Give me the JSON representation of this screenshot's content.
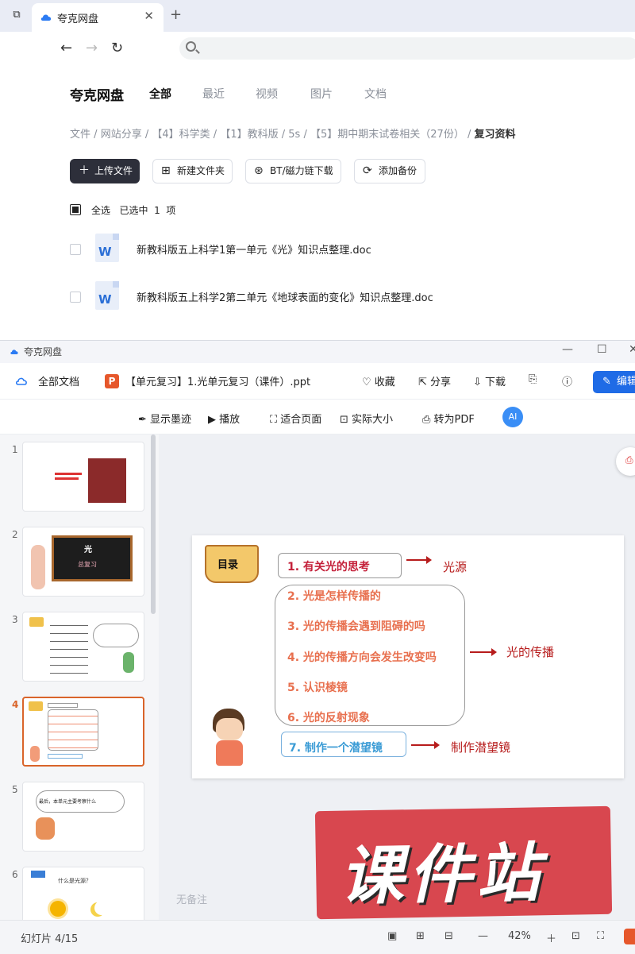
{
  "browser": {
    "tab_title": "夸克网盘",
    "close_glyph": "✕",
    "new_tab_glyph": "+"
  },
  "drive": {
    "brand": "夸克网盘",
    "tabs": [
      "全部",
      "最近",
      "视频",
      "图片",
      "文档"
    ],
    "active_tab": "全部",
    "breadcrumb": [
      "文件",
      "网站分享",
      "【4】科学类",
      "【1】教科版",
      "5s",
      "【5】期中期末试卷相关（27份）",
      "复习资料"
    ],
    "breadcrumb_sep": "/",
    "buttons": {
      "upload": "上传文件",
      "new_folder": "新建文件夹",
      "bt": "BT/磁力链下载",
      "backup": "添加备份"
    },
    "select_all": "全选",
    "selected_text": "已选中",
    "selected_count": "1",
    "selected_unit": "项",
    "files": [
      "新教科版五上科学1第一单元《光》知识点整理.doc",
      "新教科版五上科学2第二单元《地球表面的变化》知识点整理.doc"
    ],
    "doc_icon_letter": "W"
  },
  "viewer": {
    "window_title": "夸克网盘",
    "all_docs": "全部文档",
    "ppt_badge": "P",
    "file_title": "【单元复习】1.光单元复习（课件）.ppt",
    "favorite": "收藏",
    "share": "分享",
    "download": "下载",
    "edit": "编辑",
    "toolbar": {
      "ink": "显示墨迹",
      "play": "播放",
      "fit": "适合页面",
      "actual": "实际大小",
      "to_pdf": "转为PDF",
      "ai": "AI"
    },
    "thumbnails": [
      1,
      2,
      3,
      4,
      5,
      6
    ],
    "active_thumb": 4,
    "thumb2_title": "光",
    "thumb2_sub": "总复习",
    "thumb5_text": "最后，本单元主要考察什么",
    "thumb6_text": "什么是光源？",
    "notes": "无备注",
    "status_page": "幻灯片 4/15",
    "zoom": "42%"
  },
  "slide": {
    "toc_label": "目录",
    "items": [
      "1.  有关光的思考",
      "2.  光是怎样传播的",
      "3.  光的传播会遇到阻碍的吗",
      "4.  光的传播方向会发生改变吗",
      "5.  认识棱镜",
      "6.  光的反射现象",
      "7.  制作一个潜望镜"
    ],
    "labels": {
      "source": "光源",
      "propagation": "光的传播",
      "periscope": "制作潜望镜"
    },
    "colors": {
      "item1": "#c4213a",
      "middle": "#e8704f",
      "item7": "#3a9bd5",
      "label": "#b71c1c"
    }
  },
  "watermark": "课件站"
}
